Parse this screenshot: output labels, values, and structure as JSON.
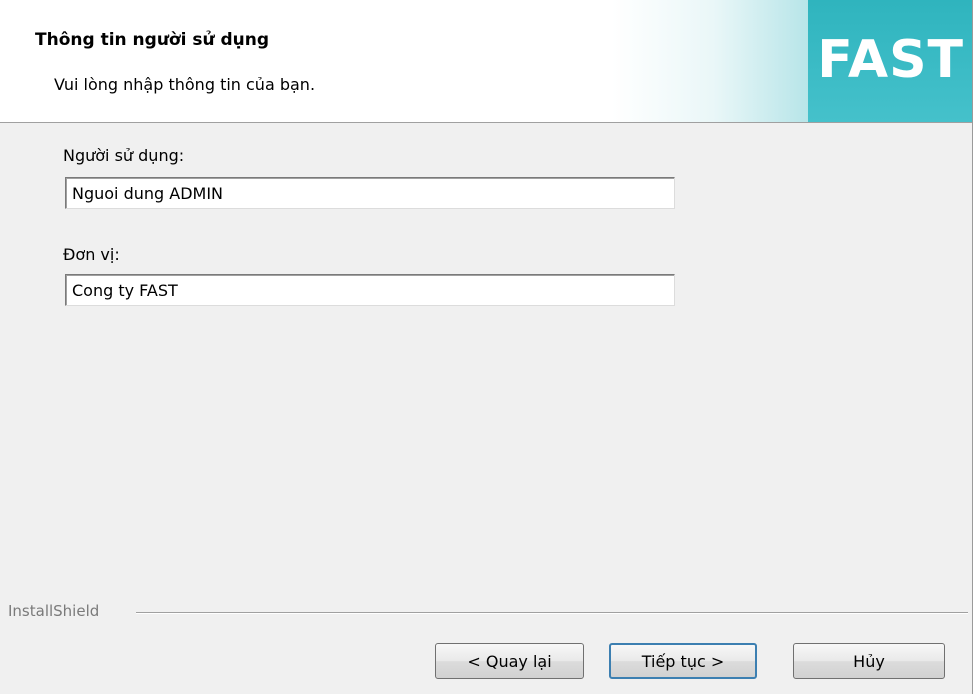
{
  "header": {
    "title": "Thông tin người sử dụng",
    "subtitle": "Vui lòng nhập thông tin của bạn.",
    "logo_text": "FAST"
  },
  "form": {
    "user": {
      "label": "Người sử dụng:",
      "value": "Nguoi dung ADMIN"
    },
    "org": {
      "label": "Đơn vị:",
      "value": "Cong ty FAST"
    }
  },
  "footer": {
    "group_label": "InstallShield",
    "back_label": "< Quay lại",
    "next_label": "Tiếp tục >",
    "cancel_label": "Hủy"
  },
  "colors": {
    "banner_accent": "#2fb4be",
    "default_button_border": "#3c7fb1"
  }
}
